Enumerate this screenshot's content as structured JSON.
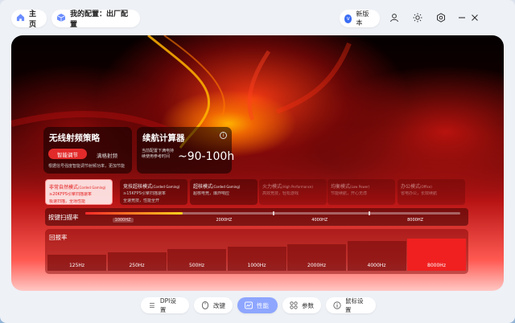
{
  "header": {
    "home_label": "主页",
    "profile_label": "我的配置：出厂配置",
    "version_label": "新版本",
    "version_icon": "v"
  },
  "rf_card": {
    "title": "无线射频策略",
    "active_option": "智能调节",
    "other_option": "满格射频",
    "desc": "根据信号强度智能调节射频功率，更加节能"
  },
  "battery_card": {
    "title": "续航计算器",
    "note": "当前配置下满电持续使用参考时间",
    "value": "~90-100h"
  },
  "modes": [
    {
      "title": "非常自然模式",
      "tag": "(Corded Gaming)",
      "desc1": "≥20KFPS引擎扫描速率",
      "desc2": "极速扫描，全场性能",
      "state": "active"
    },
    {
      "title": "竞技超核模式",
      "tag": "(Corded Gaming)",
      "desc1": "≥15KFPS引擎扫描速率",
      "desc2": "全速竞技，性能全开",
      "state": "normal"
    },
    {
      "title": "超核模式",
      "tag": "(Corded Gaming)",
      "desc1": "超核电竞，爆炸响应",
      "desc2": "",
      "state": "normal"
    },
    {
      "title": "火力模式",
      "tag": "(High Performance)",
      "desc1": "高效竞技，轻松游戏",
      "desc2": "",
      "state": "dim"
    },
    {
      "title": "均衡模式",
      "tag": "(Low Power)",
      "desc1": "节能续航，开心无虑",
      "desc2": "",
      "state": "dim"
    },
    {
      "title": "办公模式",
      "tag": "(Office)",
      "desc1": "省电办公，长效续航",
      "desc2": "",
      "state": "dim"
    }
  ],
  "scan": {
    "label": "按键扫描率",
    "ticks": [
      "1000HZ",
      "2000HZ",
      "4000HZ",
      "8000HZ"
    ],
    "selected_index": 0,
    "fill_fraction": 0.26
  },
  "report": {
    "label": "回报率",
    "bars": [
      "125Hz",
      "250Hz",
      "500Hz",
      "1000Hz",
      "2000Hz",
      "4000Hz",
      "8000Hz"
    ],
    "selected_index": 6
  },
  "nav": {
    "dpi": "DPI设置",
    "keys": "改键",
    "performance": "性能",
    "params": "参数",
    "mouse": "鼠标设置"
  },
  "colors": {
    "accent_red": "#e22a2a",
    "nav_active": "#8ea6ff",
    "version_dot": "#3a6cf4"
  }
}
